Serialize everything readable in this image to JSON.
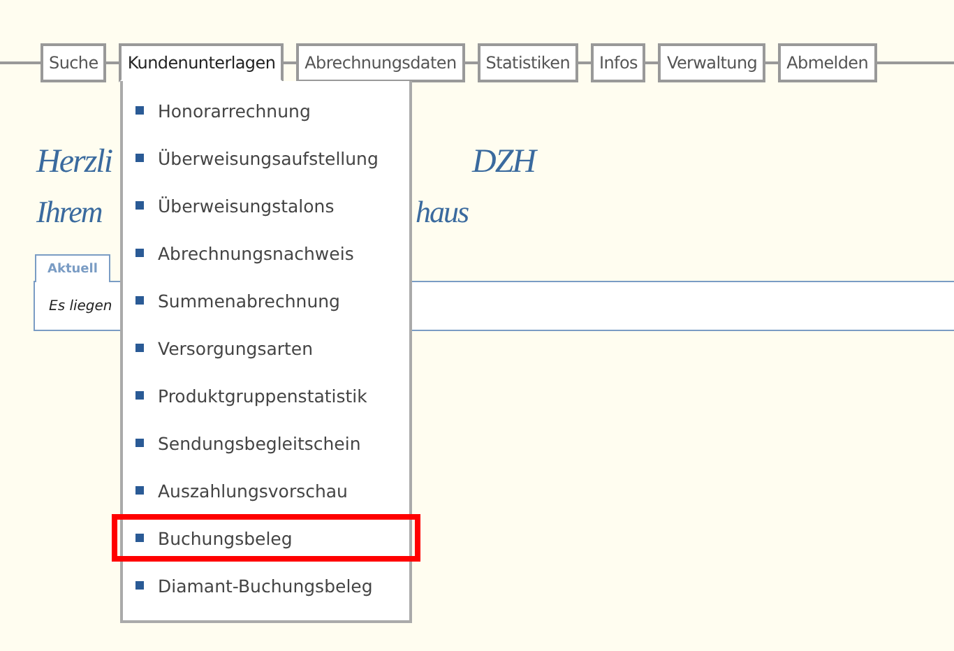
{
  "nav": [
    {
      "label": "Suche",
      "selected": false
    },
    {
      "label": "Kundenunterlagen",
      "selected": true
    },
    {
      "label": "Abrechnungsdaten",
      "selected": false
    },
    {
      "label": "Statistiken",
      "selected": false
    },
    {
      "label": "Infos",
      "selected": false
    },
    {
      "label": "Verwaltung",
      "selected": false
    },
    {
      "label": "Abmelden",
      "selected": false
    }
  ],
  "dropdown": {
    "items": [
      {
        "label": "Honorarrechnung",
        "highlighted": false
      },
      {
        "label": "Überweisungsaufstellung",
        "highlighted": false
      },
      {
        "label": "Überweisungstalons",
        "highlighted": false
      },
      {
        "label": "Abrechnungsnachweis",
        "highlighted": false
      },
      {
        "label": "Summenabrechnung",
        "highlighted": false
      },
      {
        "label": "Versorgungsarten",
        "highlighted": false
      },
      {
        "label": "Produktgruppenstatistik",
        "highlighted": false
      },
      {
        "label": "Sendungsbegleitschein",
        "highlighted": false
      },
      {
        "label": "Auszahlungsvorschau",
        "highlighted": false
      },
      {
        "label": "Buchungsbeleg",
        "highlighted": true
      },
      {
        "label": "Diamant-Buchungsbeleg",
        "highlighted": false
      }
    ]
  },
  "greeting": [
    {
      "left": "Herzli",
      "right": "DZH"
    },
    {
      "left": "Ihrem",
      "right": "haus"
    }
  ],
  "tabs": [
    {
      "label": "Aktuell",
      "selected": true
    }
  ],
  "panel": {
    "text": "Es liegen"
  }
}
